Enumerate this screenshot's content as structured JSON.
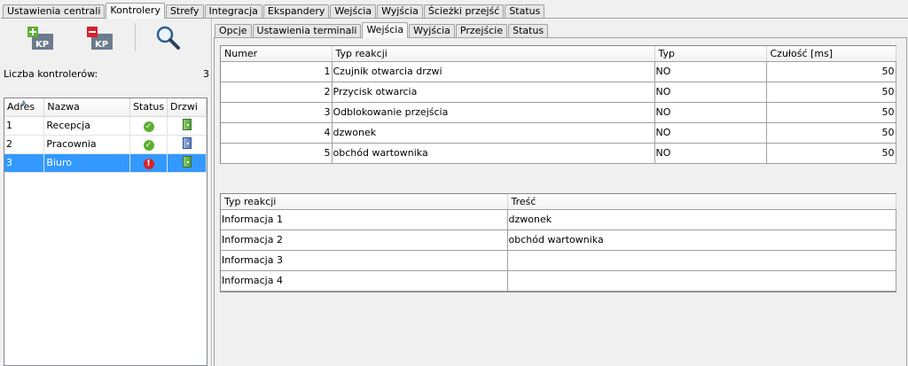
{
  "top_tabs": [
    "Ustawienia centrali",
    "Kontrolery",
    "Strefy",
    "Integracja",
    "Ekspandery",
    "Wejścia",
    "Wyjścia",
    "Ścieżki przejść",
    "Status"
  ],
  "toolbar": {
    "add_label": "KP",
    "remove_label": "KP"
  },
  "controllers": {
    "count_label": "Liczba kontrolerów:",
    "count_value": "3",
    "columns": [
      "Adres",
      "Nazwa",
      "Status",
      "Drzwi"
    ],
    "rows": [
      {
        "address": "1",
        "name": "Recepcja"
      },
      {
        "address": "2",
        "name": "Pracownia"
      },
      {
        "address": "3",
        "name": "Biuro"
      }
    ]
  },
  "sub_tabs": [
    "Opcje",
    "Ustawienia terminali",
    "Wejścia",
    "Wyjścia",
    "Przejście",
    "Status"
  ],
  "inputs_table": {
    "columns": [
      "Numer",
      "Typ reakcji",
      "Typ",
      "Czułość [ms]"
    ],
    "rows": [
      {
        "number": "1",
        "reaction": "Czujnik otwarcia drzwi",
        "type": "NO",
        "sensitivity": "50"
      },
      {
        "number": "2",
        "reaction": "Przycisk otwarcia",
        "type": "NO",
        "sensitivity": "50"
      },
      {
        "number": "3",
        "reaction": "Odblokowanie przejścia",
        "type": "NO",
        "sensitivity": "50"
      },
      {
        "number": "4",
        "reaction": "dzwonek",
        "type": "NO",
        "sensitivity": "50"
      },
      {
        "number": "5",
        "reaction": "obchód wartownika",
        "type": "NO",
        "sensitivity": "50"
      }
    ]
  },
  "info_table": {
    "columns": [
      "Typ reakcji",
      "Treść"
    ],
    "rows": [
      {
        "reaction": "Informacja 1",
        "content": "dzwonek"
      },
      {
        "reaction": "Informacja 2",
        "content": "obchód wartownika"
      },
      {
        "reaction": "Informacja 3",
        "content": ""
      },
      {
        "reaction": "Informacja 4",
        "content": ""
      }
    ]
  },
  "colors": {
    "selection": "#3399ff",
    "status_ok": "#5cb030",
    "status_error": "#d8202a"
  }
}
